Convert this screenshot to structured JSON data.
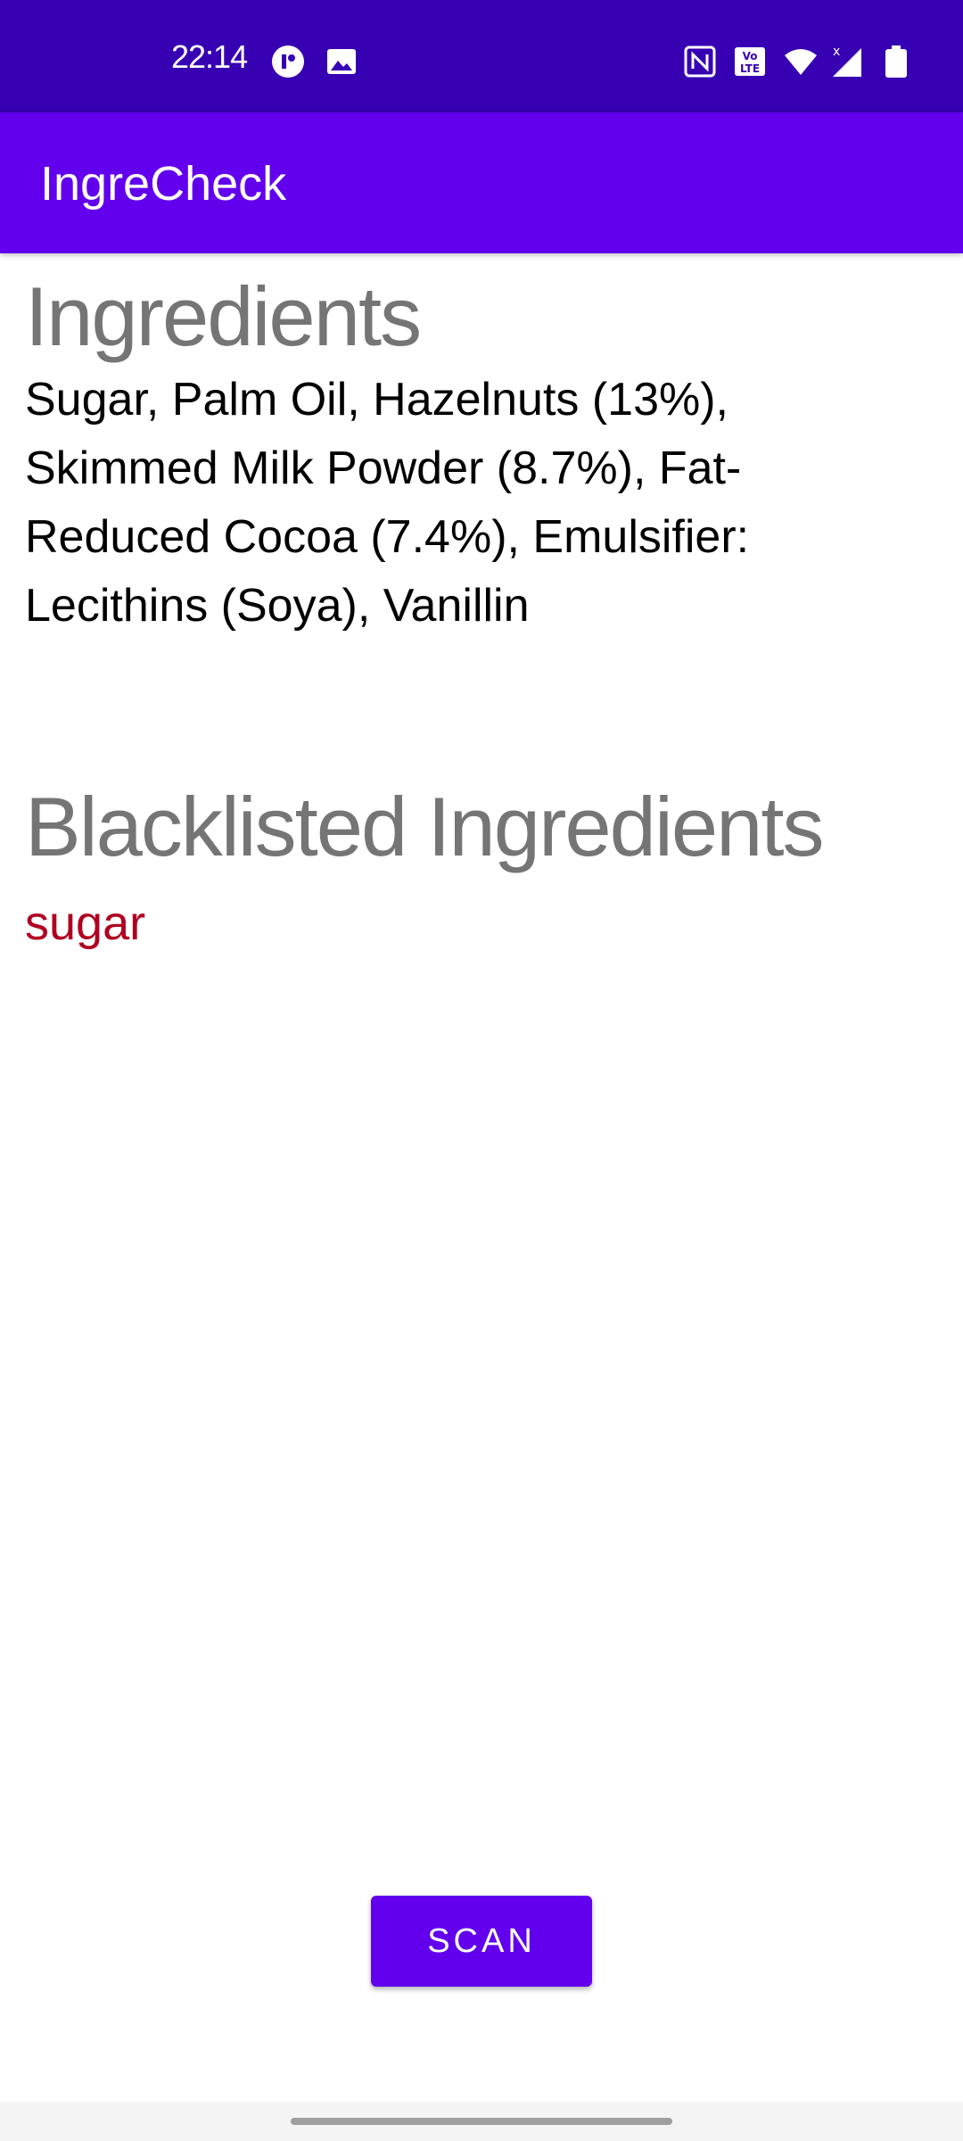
{
  "status_bar": {
    "time": "22:14",
    "left_icons": [
      "app-notification-icon",
      "image-icon"
    ],
    "right_icons": [
      "nfc-icon",
      "volte-icon",
      "wifi-icon",
      "signal-icon",
      "battery-icon"
    ]
  },
  "app_bar": {
    "title": "IngreCheck"
  },
  "ingredients": {
    "heading": "Ingredients",
    "text": "Sugar, Palm Oil, Hazelnuts (13%), Skimmed Milk Powder (8.7%), Fat-Reduced Cocoa (7.4%), Emulsifier: Lecithins (Soya), Vanillin"
  },
  "blacklist": {
    "heading": "Blacklisted Ingredients",
    "items": [
      "sugar"
    ]
  },
  "scan_button": {
    "label": "SCAN"
  },
  "colors": {
    "status_bar": "#3700b3",
    "app_bar": "#6200ee",
    "button": "#6200ee",
    "heading_text": "#757575",
    "blacklist_text": "#b00020"
  }
}
